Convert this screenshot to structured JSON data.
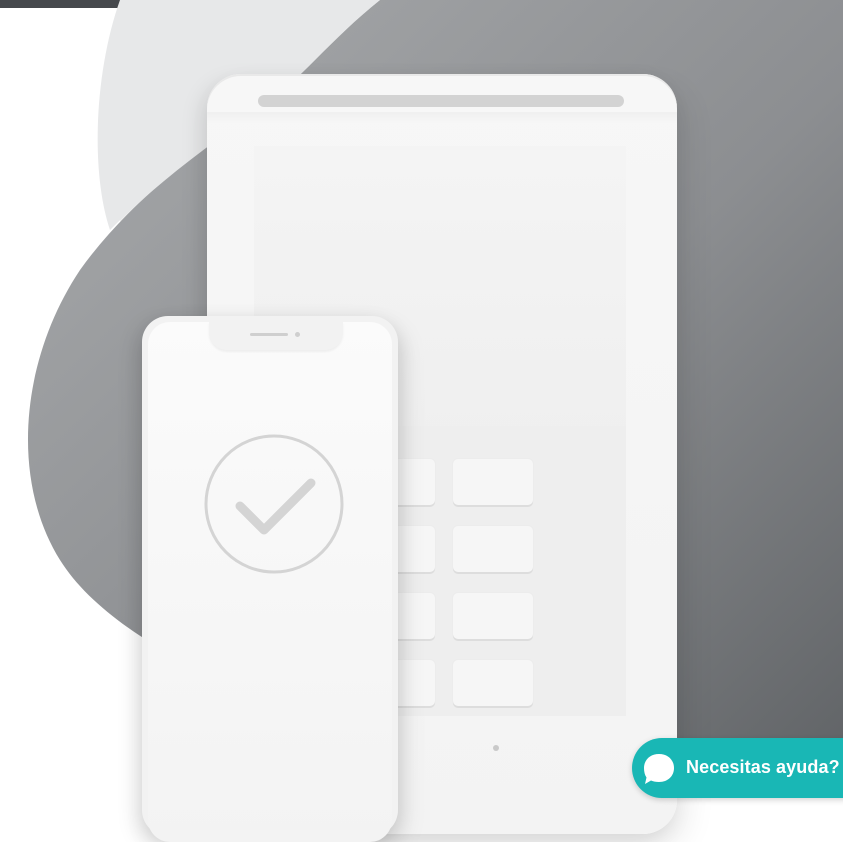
{
  "colors": {
    "top_bar": "#45484c",
    "blob_light": "#d8d9da",
    "blob_dark": "#6e7174",
    "device_body": "#f3f3f3",
    "help_button": "#19b7b5",
    "help_text": "#ffffff"
  },
  "illustration": {
    "tablet_icon": "pos-tablet-icon",
    "phone_icon": "smartphone-icon",
    "check_icon": "checkmark-circle-icon",
    "keypad_rows": 4,
    "keypad_cols": 3
  },
  "help": {
    "label": "Necesitas ayuda?",
    "icon": "chat-bubble-icon"
  }
}
